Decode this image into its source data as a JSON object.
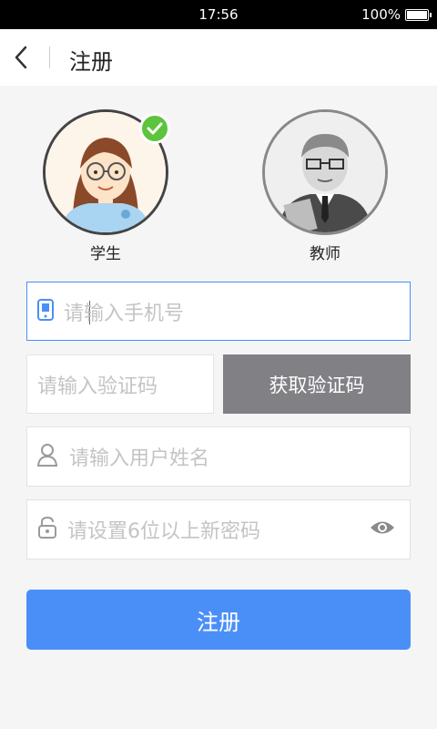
{
  "status_bar": {
    "time": "17:56",
    "battery": "100%"
  },
  "header": {
    "title": "注册"
  },
  "roles": [
    {
      "label": "学生",
      "selected": true
    },
    {
      "label": "教师",
      "selected": false
    }
  ],
  "form": {
    "phone_placeholder": "请输入手机号",
    "code_placeholder": "请输入验证码",
    "get_code_label": "获取验证码",
    "username_placeholder": "请输入用户姓名",
    "password_placeholder": "请设置6位以上新密码"
  },
  "submit_label": "注册",
  "colors": {
    "accent": "#4a8ff7",
    "check": "#5cc43d",
    "code_button": "#818185"
  },
  "icons": [
    "back-arrow-icon",
    "checkmark-icon",
    "phone-icon",
    "user-icon",
    "lock-icon",
    "eye-icon"
  ]
}
